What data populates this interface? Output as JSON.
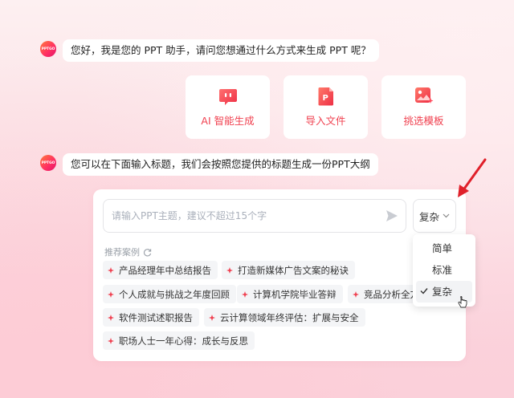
{
  "chat": {
    "avatar_label": "PPTGO",
    "greeting": "您好，我是您的 PPT 助手，请问您想通过什么方式来生成 PPT 呢？",
    "instruction": "您可以在下面输入标题，我们会按照您提供的标题生成一份PPT大纲"
  },
  "options": [
    {
      "label": "AI 智能生成",
      "icon": "ai-chat-icon"
    },
    {
      "label": "导入文件",
      "icon": "ppt-file-icon"
    },
    {
      "label": "挑选模板",
      "icon": "template-image-icon"
    }
  ],
  "input": {
    "placeholder": "请输入PPT主题，建议不超过15个字",
    "value": ""
  },
  "complexity": {
    "selected": "复杂",
    "options": [
      "简单",
      "标准",
      "复杂"
    ]
  },
  "recommend": {
    "title": "推荐案例",
    "chips": [
      "产品经理年中总结报告",
      "打造新媒体广告文案的秘诀",
      "个人成就与挑战之年度回顾",
      "计算机学院毕业答辩",
      "竞品分析全方",
      "软件测试述职报告",
      "云计算领域年终评估：扩展与安全",
      "职场人士一年心得：成长与反思"
    ]
  },
  "colors": {
    "accent": "#f0404f",
    "arrow": "#e0202a"
  }
}
